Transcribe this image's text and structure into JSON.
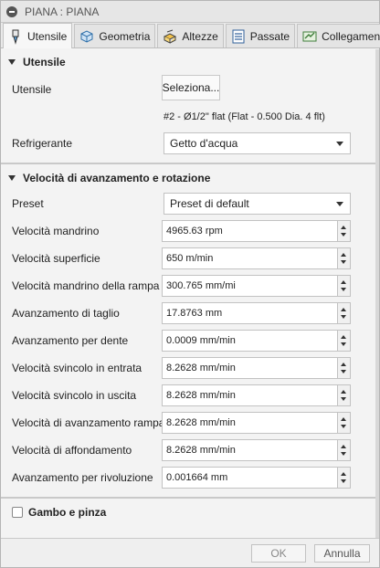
{
  "window": {
    "title": "PIANA : PIANA"
  },
  "tabs": [
    {
      "label": "Utensile",
      "icon": "tool-icon",
      "active": true
    },
    {
      "label": "Geometria",
      "icon": "geometry-icon",
      "active": false
    },
    {
      "label": "Altezze",
      "icon": "heights-icon",
      "active": false
    },
    {
      "label": "Passate",
      "icon": "passes-icon",
      "active": false
    },
    {
      "label": "Collegamenti",
      "icon": "linking-icon",
      "active": false
    }
  ],
  "tool_section": {
    "title": "Utensile",
    "tool_label": "Utensile",
    "select_button": "Seleziona...",
    "tool_description": "#2 - Ø1/2\" flat (Flat - 0.500 Dia. 4 flt)",
    "coolant_label": "Refrigerante",
    "coolant_value": "Getto d'acqua"
  },
  "feed_section": {
    "title": "Velocità di avanzamento e rotazione",
    "preset_label": "Preset",
    "preset_value": "Preset di default",
    "fields": [
      {
        "label": "Velocità mandrino",
        "value": "4965.63 rpm"
      },
      {
        "label": "Velocità superficie",
        "value": "650 m/min"
      },
      {
        "label": "Velocità mandrino della rampa",
        "value": "300.765 mm/mi"
      },
      {
        "label": "Avanzamento di taglio",
        "value": "17.8763 mm"
      },
      {
        "label": "Avanzamento per dente",
        "value": "0.0009 mm/min"
      },
      {
        "label": "Velocità svincolo in entrata",
        "value": "8.2628 mm/min"
      },
      {
        "label": "Velocità svincolo in uscita",
        "value": "8.2628 mm/min"
      },
      {
        "label": "Velocità di avanzamento rampa",
        "value": "8.2628 mm/min"
      },
      {
        "label": "Velocità di affondamento",
        "value": "8.2628 mm/min"
      },
      {
        "label": "Avanzamento per rivoluzione",
        "value": "0.001664 mm"
      }
    ]
  },
  "holder_section": {
    "title": "Gambo e pinza",
    "checked": false
  },
  "footer": {
    "ok_label": "OK",
    "cancel_label": "Annulla"
  }
}
